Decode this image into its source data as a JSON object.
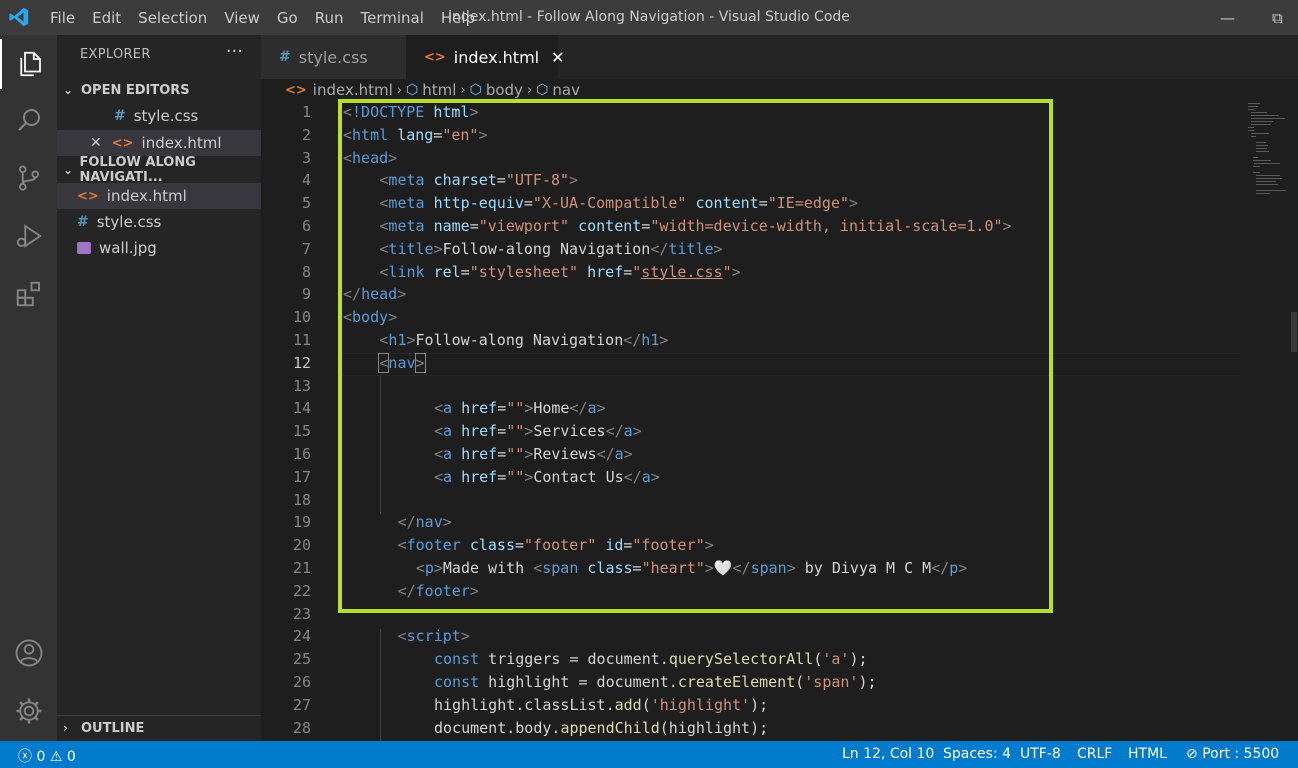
{
  "window": {
    "title": "index.html - Follow Along Navigation - Visual Studio Code",
    "menu": [
      "File",
      "Edit",
      "Selection",
      "View",
      "Go",
      "Run",
      "Terminal",
      "Help"
    ],
    "controls": {
      "minimize": "—",
      "restore": "⧉"
    }
  },
  "sidebar": {
    "title": "EXPLORER",
    "more": "···",
    "open_editors": {
      "label": "OPEN EDITORS",
      "items": [
        {
          "name": "style.css",
          "icon": "css-hash-icon"
        },
        {
          "name": "index.html",
          "icon": "html-icon",
          "close": "✕"
        }
      ]
    },
    "folder": {
      "label": "FOLLOW ALONG NAVIGATI...",
      "items": [
        {
          "name": "index.html",
          "icon": "html-icon"
        },
        {
          "name": "style.css",
          "icon": "css-hash-icon"
        },
        {
          "name": "wall.jpg",
          "icon": "image-icon"
        }
      ]
    },
    "outline": {
      "label": "OUTLINE"
    }
  },
  "tabs": [
    {
      "label": "style.css",
      "active": false
    },
    {
      "label": "index.html",
      "active": true,
      "close": "✕"
    }
  ],
  "breadcrumb": [
    "index.html",
    "html",
    "body",
    "nav"
  ],
  "editor": {
    "current_line": 12,
    "line_numbers": [
      "1",
      "2",
      "3",
      "4",
      "5",
      "6",
      "7",
      "8",
      "9",
      "10",
      "11",
      "12",
      "13",
      "14",
      "15",
      "16",
      "17",
      "18",
      "19",
      "20",
      "21",
      "22",
      "23",
      "24",
      "25",
      "26",
      "27",
      "28"
    ]
  },
  "status": {
    "errors": "0",
    "warnings": "0",
    "position": "Ln 12, Col 10",
    "spaces": "Spaces: 4",
    "encoding": "UTF-8",
    "eol": "CRLF",
    "language": "HTML",
    "port": "Port : 5500"
  },
  "colors": {
    "accent": "#007acc",
    "highlight_box": "#b7e02b"
  }
}
